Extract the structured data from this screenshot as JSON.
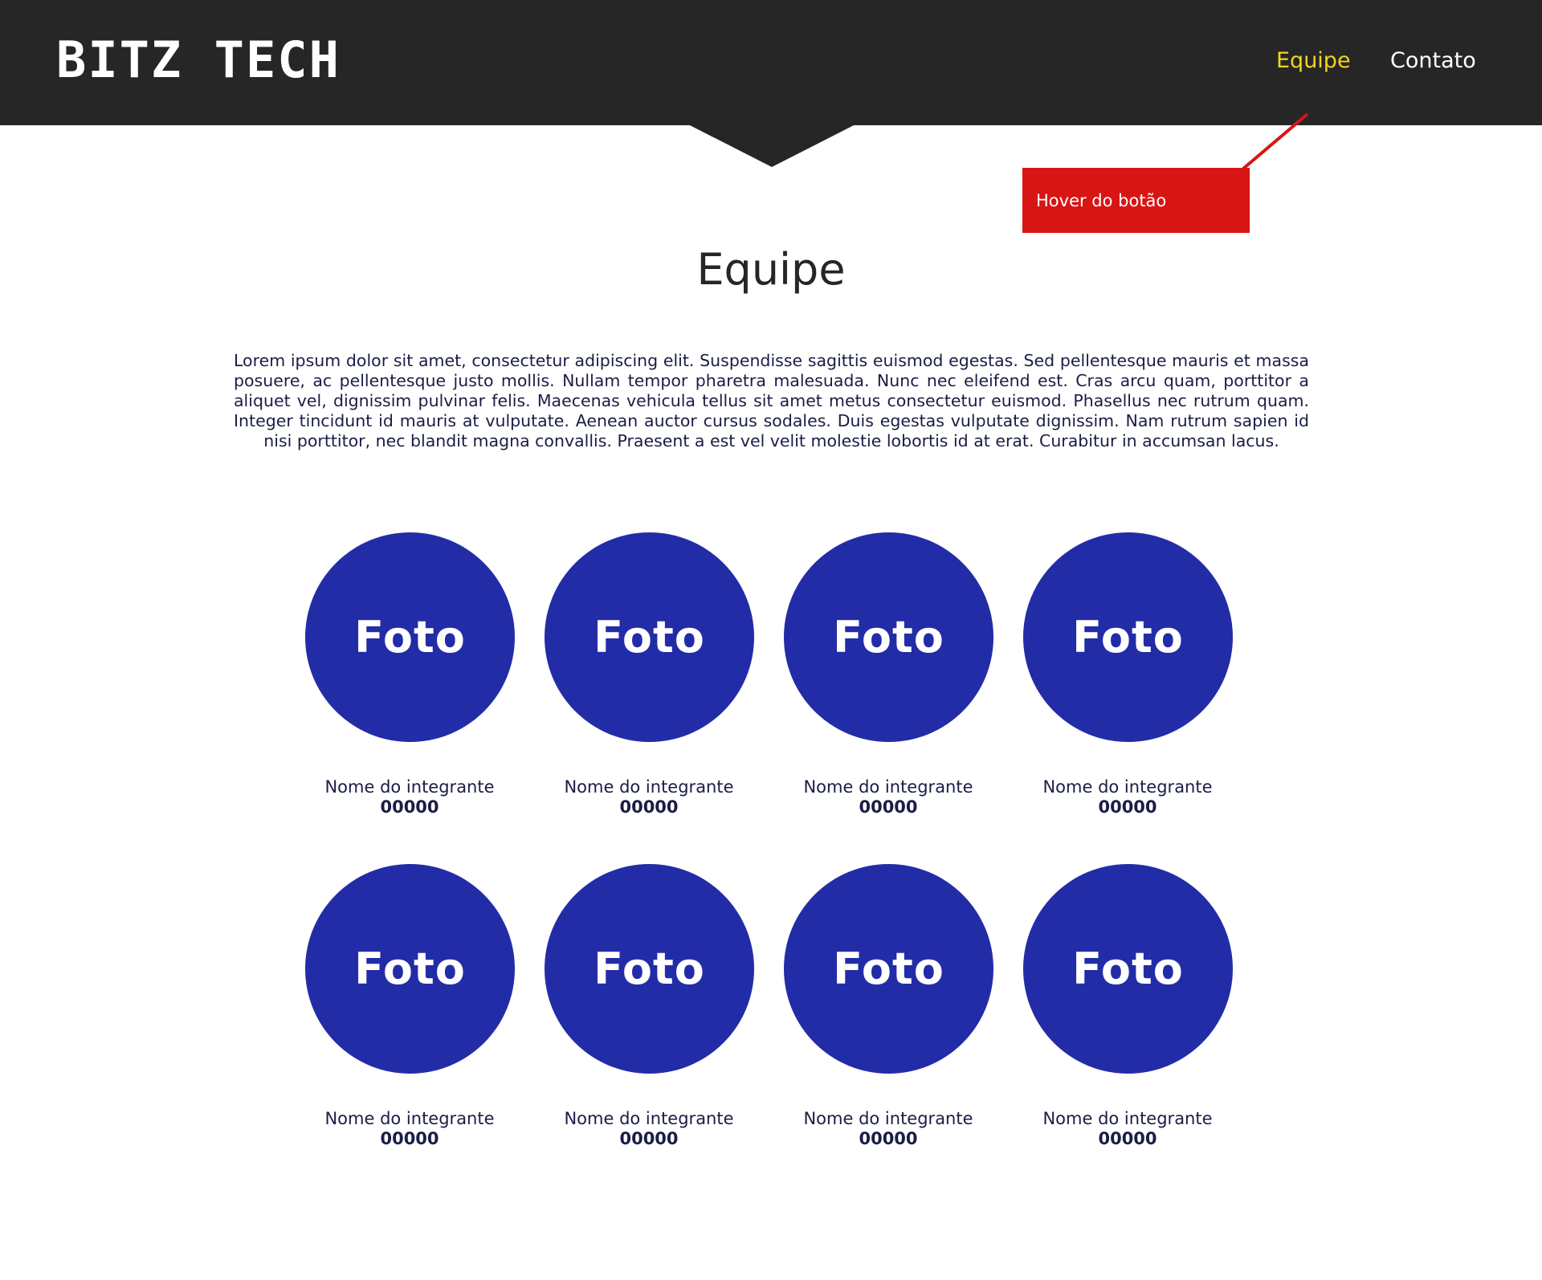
{
  "header": {
    "logo": "BITZ TECH",
    "nav": [
      {
        "label": "Equipe",
        "active": true,
        "color": "#f2d51c"
      },
      {
        "label": "Contato",
        "active": false,
        "color": "#ffffff"
      }
    ],
    "background_color": "#262626"
  },
  "annotation": {
    "label": "Hover do botão",
    "color": "#d71515"
  },
  "main": {
    "title": "Equipe",
    "intro": "Lorem ipsum dolor sit amet, consectetur adipiscing elit. Suspendisse sagittis euismod egestas. Sed pellentesque mauris et massa posuere, ac pellentesque justo mollis. Nullam tempor pharetra malesuada. Nunc nec eleifend est. Cras arcu quam, porttitor a aliquet vel, dignissim pulvinar felis. Maecenas vehicula tellus sit amet metus consectetur euismod. Phasellus nec rutrum quam. Integer tincidunt id mauris at vulputate. Aenean auctor cursus sodales. Duis egestas vulputate dignissim. Nam rutrum sapien id nisi porttitor, nec blandit magna convallis. Praesent a est vel velit molestie lobortis id at erat. Curabitur in accumsan lacus.",
    "photo_color": "#232ca7",
    "members": [
      {
        "photo": "Foto",
        "name": "Nome do integrante",
        "id": "00000"
      },
      {
        "photo": "Foto",
        "name": "Nome do integrante",
        "id": "00000"
      },
      {
        "photo": "Foto",
        "name": "Nome do integrante",
        "id": "00000"
      },
      {
        "photo": "Foto",
        "name": "Nome do integrante",
        "id": "00000"
      },
      {
        "photo": "Foto",
        "name": "Nome do integrante",
        "id": "00000"
      },
      {
        "photo": "Foto",
        "name": "Nome do integrante",
        "id": "00000"
      },
      {
        "photo": "Foto",
        "name": "Nome do integrante",
        "id": "00000"
      },
      {
        "photo": "Foto",
        "name": "Nome do integrante",
        "id": "00000"
      }
    ]
  }
}
